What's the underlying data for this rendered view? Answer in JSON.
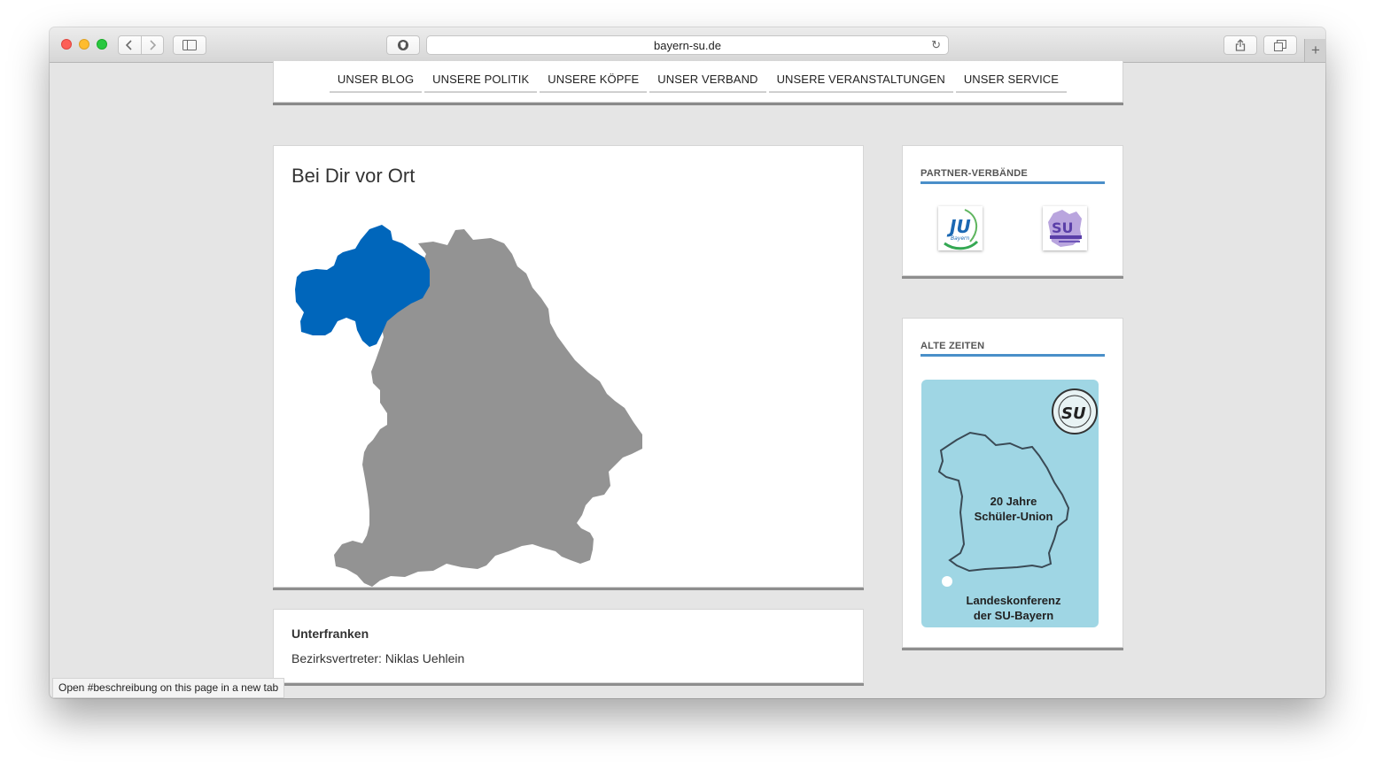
{
  "browser": {
    "url": "bayern-su.de",
    "status_text": "Open #beschreibung on this page in a new tab"
  },
  "nav": {
    "items": [
      "UNSER BLOG",
      "UNSERE POLITIK",
      "UNSERE KÖPFE",
      "UNSER VERBAND",
      "UNSERE VERANSTALTUNGEN",
      "UNSER SERVICE"
    ]
  },
  "main": {
    "title": "Bei Dir vor Ort",
    "highlight_color": "#0066bb",
    "region_color": "#939393"
  },
  "district": {
    "name": "Unterfranken",
    "representative": "Bezirksvertreter: Niklas Uehlein"
  },
  "sidebar": {
    "partner_title": "PARTNER-VERBÄNDE",
    "partner_logos": [
      "JU",
      "SU"
    ],
    "old_title": "ALTE ZEITEN",
    "poster": {
      "line1": "20 Jahre",
      "line2": "Schüler-Union",
      "line3": "Landeskonferenz",
      "line4": "der SU-Bayern",
      "badge": "SU"
    }
  }
}
